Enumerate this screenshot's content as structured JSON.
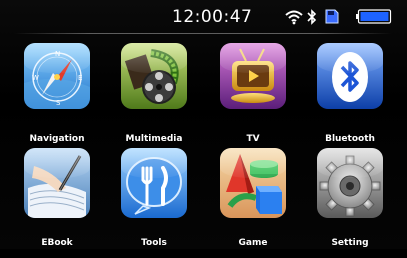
{
  "status_bar": {
    "time": "12:00:47",
    "icons": [
      "wifi-icon",
      "bluetooth-icon",
      "sd-card-icon",
      "battery-icon"
    ],
    "battery_level": 0.9
  },
  "colors": {
    "battery": "#1e63ff",
    "sd_card": "#3b6cff",
    "background": "#000000"
  },
  "apps": [
    {
      "label": "Navigation",
      "icon": "compass-icon"
    },
    {
      "label": "Multimedia",
      "icon": "film-reel-icon"
    },
    {
      "label": "TV",
      "icon": "tv-icon"
    },
    {
      "label": "Bluetooth",
      "icon": "bluetooth-icon"
    },
    {
      "label": "EBook",
      "icon": "ebook-icon"
    },
    {
      "label": "Tools",
      "icon": "fork-knife-icon"
    },
    {
      "label": "Game",
      "icon": "game-shapes-icon"
    },
    {
      "label": "Setting",
      "icon": "gear-icon"
    }
  ]
}
